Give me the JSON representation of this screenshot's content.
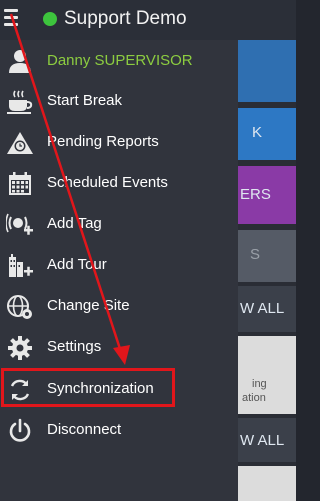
{
  "app": {
    "title": "Support Demo",
    "status_color": "#3dc43d"
  },
  "background": {
    "tile_labels": [
      "K",
      "ERS",
      "S",
      "W ALL",
      "ing",
      "ation",
      "W ALL"
    ]
  },
  "drawer": {
    "user_name": "Danny SUPERVISOR",
    "items": [
      {
        "label": "Start Break",
        "icon": "coffee-cup-icon"
      },
      {
        "label": "Pending Reports",
        "icon": "clock-report-icon"
      },
      {
        "label": "Scheduled Events",
        "icon": "calendar-icon"
      },
      {
        "label": "Add Tag",
        "icon": "add-tag-icon"
      },
      {
        "label": "Add Tour",
        "icon": "add-tour-icon"
      },
      {
        "label": "Change Site",
        "icon": "globe-gear-icon"
      },
      {
        "label": "Settings",
        "icon": "gear-icon"
      },
      {
        "label": "Synchronization",
        "icon": "sync-icon"
      },
      {
        "label": "Disconnect",
        "icon": "power-icon"
      }
    ],
    "highlighted_item": "Synchronization"
  },
  "annotation": {
    "color": "#e1161b"
  }
}
